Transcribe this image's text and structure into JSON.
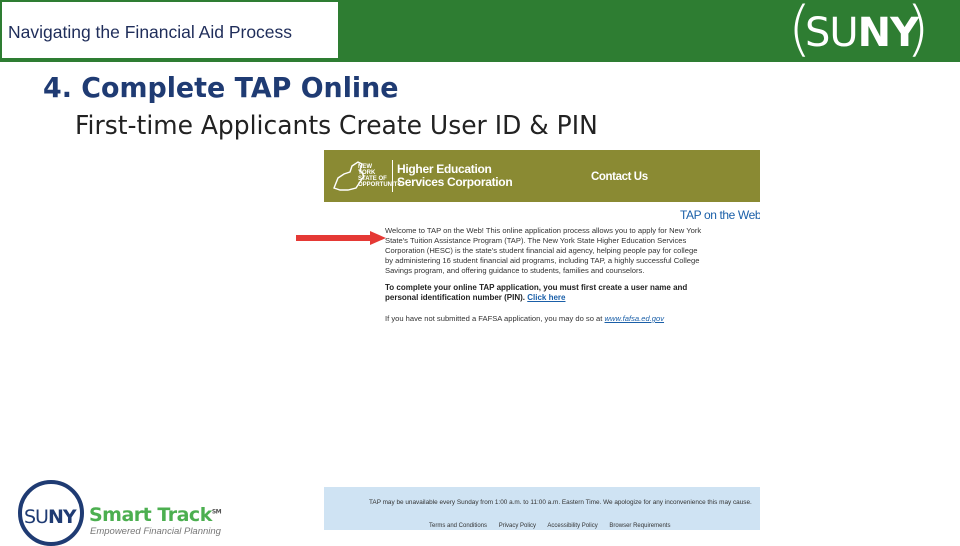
{
  "header": {
    "title": "Navigating the Financial Aid Process",
    "logo_text_light": "SU",
    "logo_text_bold": "NY",
    "paren_left": "(",
    "paren_right": ")"
  },
  "slide": {
    "heading": "4. Complete TAP Online",
    "subheading": "First-time Applicants Create User ID & PIN"
  },
  "screenshot": {
    "header_bar": {
      "ny_logo_text": "NEW YORK STATE OF OPPORTUNITY.",
      "org_line1": "Higher Education",
      "org_line2": "Services Corporation",
      "contact_link": "Contact Us"
    },
    "page_title": "TAP on the Web",
    "welcome_text": "Welcome to TAP on the Web! This online application process allows you to apply for New York State's Tuition Assistance Program (TAP). The New York State Higher Education Services Corporation (HESC) is the state's student financial aid agency, helping people pay for college by administering 16 student financial aid programs, including TAP, a highly successful College Savings program, and offering guidance to students, families and counselors.",
    "complete_text": "To complete your online TAP application, you must first create a user name and personal identification number (PIN).",
    "click_here_link": "Click here",
    "fafsa_text": "If you have not submitted a FAFSA application, you may do so at",
    "fafsa_link": "www.fafsa.ed.gov",
    "footer": {
      "maintenance_text": "TAP may be unavailable every Sunday from 1:00 a.m. to 11:00 a.m. Eastern Time. We apologize for any inconvenience this may cause.",
      "links": [
        "Terms and Conditions",
        "Privacy Policy",
        "Accessibility Policy",
        "Browser Requirements"
      ]
    }
  },
  "bottom_logo": {
    "suny_light": "SU",
    "suny_bold": "NY",
    "brand": "Smart Track",
    "trademark": "SM",
    "tagline": "Empowered Financial Planning"
  },
  "colors": {
    "top_bar": "#2e7d32",
    "heading": "#1f3b73",
    "hesc_bar": "#8a8a33",
    "arrow": "#e53935",
    "link": "#1a5fa8",
    "footer_bg": "#cfe3f3"
  }
}
